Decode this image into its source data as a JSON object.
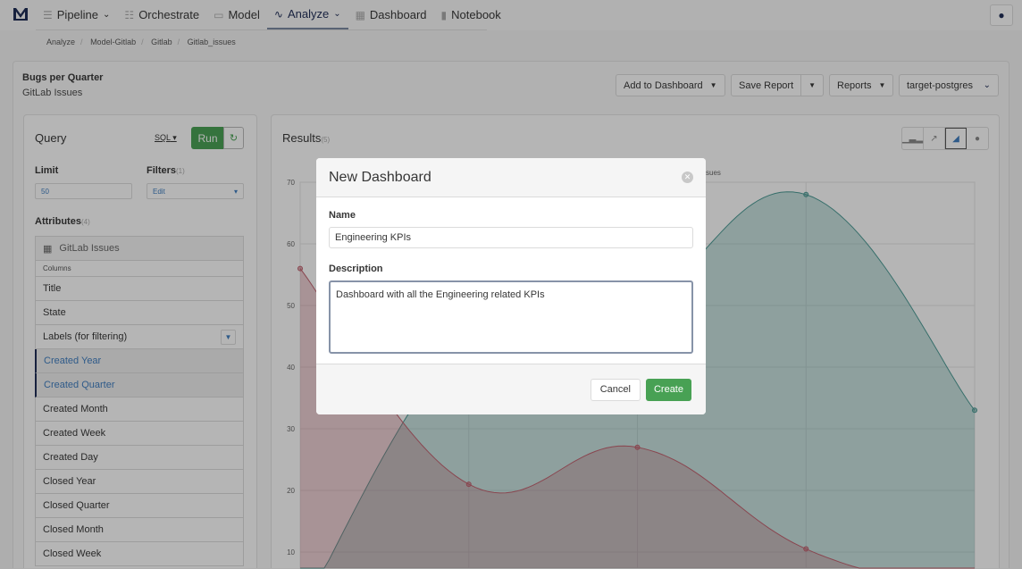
{
  "nav": {
    "items": [
      {
        "label": "Pipeline",
        "icon": "menu-icon",
        "dropdown": true
      },
      {
        "label": "Orchestrate",
        "icon": "flow-icon"
      },
      {
        "label": "Model",
        "icon": "file-icon"
      },
      {
        "label": "Analyze",
        "icon": "chart-icon",
        "dropdown": true,
        "active": true
      },
      {
        "label": "Dashboard",
        "icon": "grid-icon"
      },
      {
        "label": "Notebook",
        "icon": "book-icon"
      }
    ]
  },
  "breadcrumb": [
    "Analyze",
    "Model-Gitlab",
    "Gitlab",
    "Gitlab_issues"
  ],
  "report": {
    "title": "Bugs per Quarter",
    "subtitle": "GitLab Issues"
  },
  "toolbar": {
    "add_to_dashboard": "Add to Dashboard",
    "save_report": "Save Report",
    "reports": "Reports",
    "connection": "target-postgres"
  },
  "query": {
    "title": "Query",
    "sql": "SQL",
    "run": "Run",
    "limit_label": "Limit",
    "limit_value": "50",
    "filters_label": "Filters",
    "filters_count": "(1)",
    "filters_value": "Edit",
    "attributes_label": "Attributes",
    "attributes_count": "(4)",
    "table": "GitLab Issues",
    "columns_label": "Columns",
    "columns": [
      {
        "label": "Title"
      },
      {
        "label": "State"
      },
      {
        "label": "Labels (for filtering)",
        "filter": true
      },
      {
        "label": "Created Year",
        "selected": true
      },
      {
        "label": "Created Quarter",
        "selected": true
      },
      {
        "label": "Created Month"
      },
      {
        "label": "Created Week"
      },
      {
        "label": "Created Day"
      },
      {
        "label": "Closed Year"
      },
      {
        "label": "Closed Quarter"
      },
      {
        "label": "Closed Month"
      },
      {
        "label": "Closed Week"
      }
    ]
  },
  "results": {
    "title": "Results",
    "count": "(5)",
    "chart_types": [
      "bar-chart-icon",
      "line-chart-icon",
      "area-chart-icon",
      "pie-chart-icon"
    ],
    "active_chart": "area-chart-icon"
  },
  "chart_data": {
    "type": "area",
    "ylim": [
      0,
      70
    ],
    "yticks": [
      "10",
      "20",
      "30",
      "40",
      "50",
      "60",
      "70"
    ],
    "grid": true,
    "legend_partial": "ssues",
    "series": [
      {
        "color": "#c0606e",
        "values": [
          56,
          21,
          27,
          10.5,
          3
        ]
      },
      {
        "color": "#4a9a94",
        "values": [
          0,
          45,
          50,
          68,
          33
        ]
      }
    ]
  },
  "modal": {
    "title": "New Dashboard",
    "name_label": "Name",
    "name_value": "Engineering KPIs",
    "description_label": "Description",
    "description_value": "Dashboard with all the Engineering related KPIs",
    "cancel": "Cancel",
    "create": "Create"
  }
}
